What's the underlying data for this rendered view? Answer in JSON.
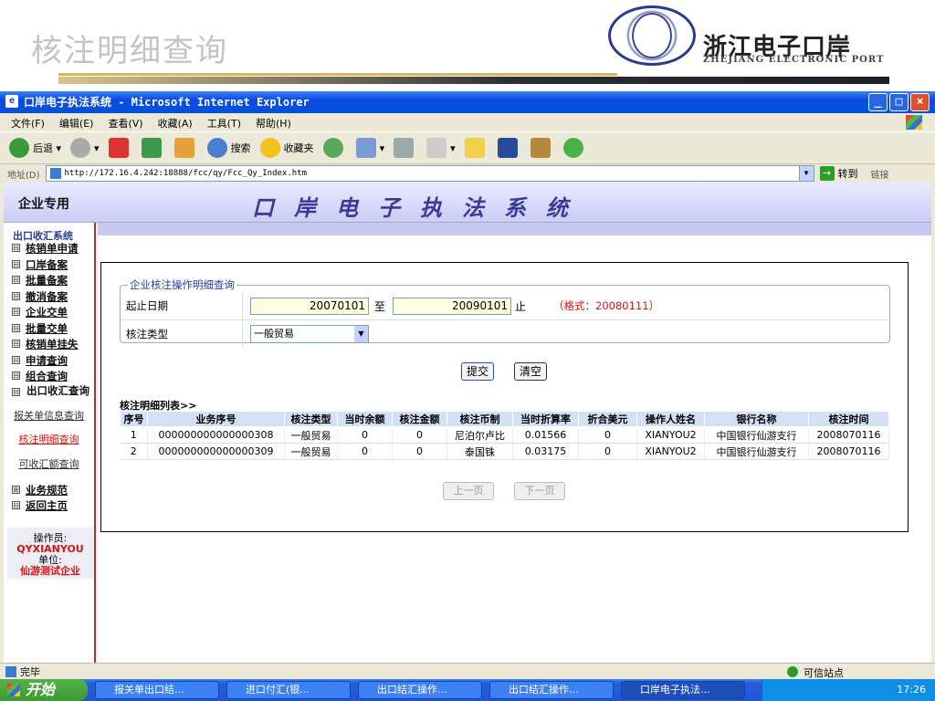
{
  "banner": {
    "title": "核注明细查询",
    "brand_cn": "浙江电子口岸",
    "brand_en": "ZHEJIANG ELECTRONIC PORT"
  },
  "window": {
    "title": "口岸电子执法系统 - Microsoft Internet Explorer"
  },
  "menu": [
    "文件(F)",
    "编辑(E)",
    "查看(V)",
    "收藏(A)",
    "工具(T)",
    "帮助(H)"
  ],
  "toolbar": {
    "back": "后退",
    "search": "搜索",
    "favorites": "收藏夹"
  },
  "address": {
    "label": "地址(D)",
    "url": "http://172.16.4.242:18888/fcc/qy/Fcc_Qy_Index.htm",
    "go": "转到",
    "links": "链接"
  },
  "app": {
    "ent_label": "企业专用",
    "sys_title": "口岸电子执法系统"
  },
  "nav": {
    "head": "出口收汇系统",
    "items": [
      {
        "label": "核销单申请",
        "box": "⊟"
      },
      {
        "label": "口岸备案",
        "box": "⊟"
      },
      {
        "label": "批量备案",
        "box": "⊟"
      },
      {
        "label": "撤消备案",
        "box": "⊟"
      },
      {
        "label": "企业交单",
        "box": "⊟"
      },
      {
        "label": "批量交单",
        "box": "⊟"
      },
      {
        "label": "核销单挂失",
        "box": "⊟"
      },
      {
        "label": "申请查询",
        "box": "⊟"
      },
      {
        "label": "组合查询",
        "box": "⊟"
      },
      {
        "label": "出口收汇查询",
        "box": "⊟"
      }
    ],
    "sub": [
      "报关单信息查询",
      "核注明细查询",
      "可收汇额查询"
    ],
    "items2": [
      {
        "label": "业务规范",
        "box": "⊞"
      },
      {
        "label": "返回主页",
        "box": "⊟"
      }
    ],
    "operator_label": "操作员:",
    "operator": "QYXIANYOU",
    "unit_label": "单位:",
    "unit": "仙游测试企业"
  },
  "form": {
    "legend": "企业核注操作明细查询",
    "date_label": "起止日期",
    "date_from": "20070101",
    "to": "至",
    "date_to": "20090101",
    "stop": "止",
    "hint": "（格式：20080111）",
    "type_label": "核注类型",
    "type_value": "一般贸易",
    "submit": "提交",
    "clear": "清空"
  },
  "list": {
    "title": "核注明细列表>>",
    "headers": [
      "序号",
      "业务序号",
      "核注类型",
      "当时余额",
      "核注金额",
      "核注币制",
      "当时折算率",
      "折合美元",
      "操作人姓名",
      "银行名称",
      "核注时间"
    ],
    "rows": [
      [
        "1",
        "000000000000000308",
        "一般贸易",
        "0",
        "0",
        "尼泊尔卢比",
        "0.01566",
        "0",
        "XIANYOU2",
        "中国银行仙游支行",
        "2008070116"
      ],
      [
        "2",
        "000000000000000309",
        "一般贸易",
        "0",
        "0",
        "泰国铢",
        "0.03175",
        "0",
        "XIANYOU2",
        "中国银行仙游支行",
        "2008070116"
      ]
    ],
    "prev": "上一页",
    "next": "下一页"
  },
  "status": {
    "text": "完毕",
    "zone": "可信站点"
  },
  "taskbar": {
    "start": "开始",
    "tasks": [
      "报关单出口结...",
      "进口付汇(银...",
      "出口结汇操作...",
      "出口结汇操作...",
      "口岸电子执法..."
    ],
    "clock": "17:26"
  }
}
